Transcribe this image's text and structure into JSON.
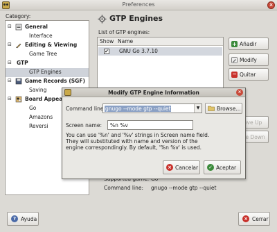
{
  "window": {
    "title": "Preferences"
  },
  "category_label": "Category:",
  "tree": [
    {
      "label": "General",
      "kind": "parent",
      "expander": "⊟"
    },
    {
      "label": "Interface",
      "kind": "child"
    },
    {
      "label": "Editing & Viewing",
      "kind": "parent",
      "expander": "⊟"
    },
    {
      "label": "Game Tree",
      "kind": "child"
    },
    {
      "label": "GTP",
      "kind": "plain",
      "expander": "⊟"
    },
    {
      "label": "GTP Engines",
      "kind": "child"
    },
    {
      "label": "Game Records (SGF)",
      "kind": "parent",
      "expander": "⊟"
    },
    {
      "label": "Saving",
      "kind": "child"
    },
    {
      "label": "Board Appea",
      "kind": "parent",
      "expander": "⊟"
    },
    {
      "label": "Go",
      "kind": "child"
    },
    {
      "label": "Amazons",
      "kind": "child"
    },
    {
      "label": "Reversi",
      "kind": "child"
    }
  ],
  "page": {
    "heading": "GTP Engines",
    "list_label": "List of GTP engines:"
  },
  "engine_list": {
    "headers": {
      "show": "Show",
      "name": "Name"
    },
    "rows": [
      {
        "checked": "✔",
        "name": "GNU Go 3.7.10"
      }
    ]
  },
  "side_buttons": {
    "add": "Añadir",
    "modify": "Modify",
    "remove": "Quitar",
    "move_up": "ove Up",
    "move_down": "ve Down"
  },
  "details": {
    "supported_label": "Supported game:",
    "supported_value": "Go",
    "cmd_label": "Command line:",
    "cmd_value": "gnugo --mode gtp --quiet"
  },
  "dialog": {
    "title": "Modify GTP Engine Information",
    "command_label": "Command line:",
    "command_value": "gnugo --mode gtp --quiet",
    "browse": "Browse...",
    "screen_name_label": "Screen name:",
    "screen_name_value": "%n %v",
    "help": [
      "You can use '%n' and '%v' strings in Screen name field.",
      "They will substituted with name and version of the",
      "engine correspondingly. By default, '%n %v' is used."
    ],
    "cancel": "Cancelar",
    "accept": "Aceptar"
  },
  "footer": {
    "help": "Ayuda",
    "close": "Cerrar"
  },
  "colors": {
    "add": "#3a8a3a",
    "remove": "#c8302a",
    "cancel": "#c8302a",
    "accept": "#3a8a3a"
  }
}
